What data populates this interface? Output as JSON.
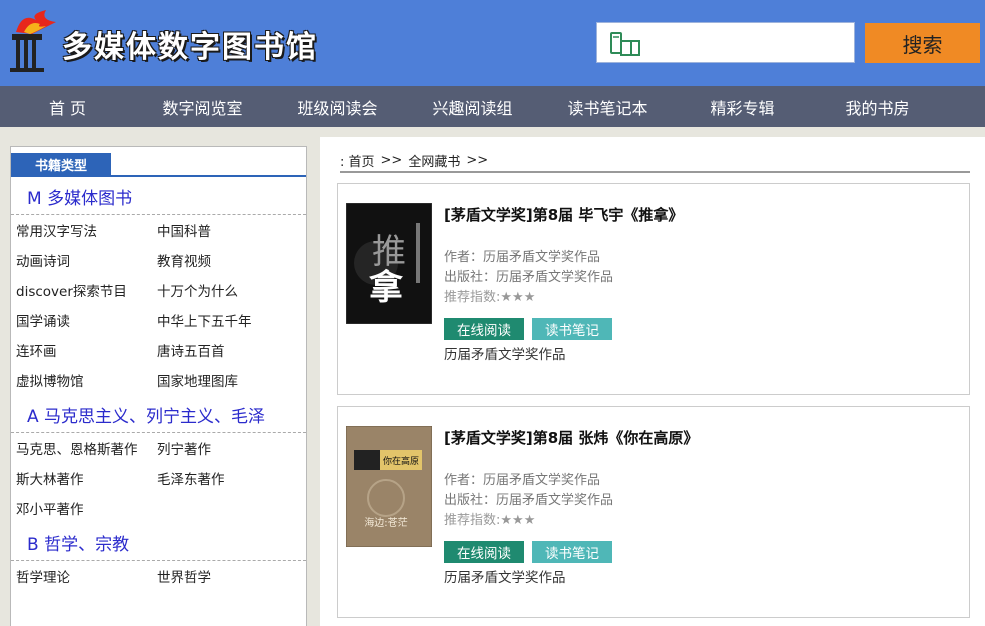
{
  "header": {
    "logo_text": "多媒体数字图书馆",
    "search_placeholder": "",
    "search_button": "搜索"
  },
  "nav": [
    {
      "label": "首 页",
      "width": 135
    },
    {
      "label": "数字阅览室",
      "width": 135
    },
    {
      "label": "班级阅读会",
      "width": 135
    },
    {
      "label": "兴趣阅读组",
      "width": 135
    },
    {
      "label": "读书笔记本",
      "width": 135
    },
    {
      "label": "精彩专辑",
      "width": 135
    },
    {
      "label": "我的书房",
      "width": 135
    }
  ],
  "sidebar": {
    "header": "书籍类型",
    "categories": [
      {
        "title": "M 多媒体图书",
        "links": [
          "常用汉字写法",
          "中国科普",
          "动画诗词",
          "教育视频",
          "discover探索节目",
          "十万个为什么",
          "国学诵读",
          "中华上下五千年",
          "连环画",
          "唐诗五百首",
          "虚拟博物馆",
          "国家地理图库"
        ]
      },
      {
        "title": "A 马克思主义、列宁主义、毛泽",
        "links": [
          "马克思、恩格斯著作",
          "列宁著作",
          "斯大林著作",
          "毛泽东著作",
          "邓小平著作"
        ]
      },
      {
        "title": "B 哲学、宗教",
        "links": [
          "哲学理论",
          "世界哲学"
        ]
      }
    ]
  },
  "breadcrumb": [
    ": 首页",
    ">>",
    "全网藏书",
    ">>"
  ],
  "books": [
    {
      "title": "[茅盾文学奖]第8届 毕飞宇《推拿》",
      "author": "作者：历届矛盾文学奖作品",
      "publisher": "出版社：历届矛盾文学奖作品",
      "rating": "推荐指数:★★★",
      "read_btn": "在线阅读",
      "note_btn": "读书笔记",
      "desc": "历届矛盾文学奖作品",
      "cover_text_top": "推",
      "cover_text_bottom": "拿"
    },
    {
      "title": "[茅盾文学奖]第8届 张炜《你在高原》",
      "author": "作者：历届矛盾文学奖作品",
      "publisher": "出版社：历届矛盾文学奖作品",
      "rating": "推荐指数:★★★",
      "read_btn": "在线阅读",
      "note_btn": "读书笔记",
      "desc": "历届矛盾文学奖作品",
      "cover_text_top": "你在高原",
      "cover_text_bottom": "海边:苍茫"
    }
  ],
  "colors": {
    "header_bg": "#4e7fd8",
    "nav_bg": "#555d74",
    "search_btn": "#f08a24",
    "read_btn": "#1f8a70",
    "note_btn": "#4fb7b7",
    "category_title": "#2b2bcc"
  }
}
